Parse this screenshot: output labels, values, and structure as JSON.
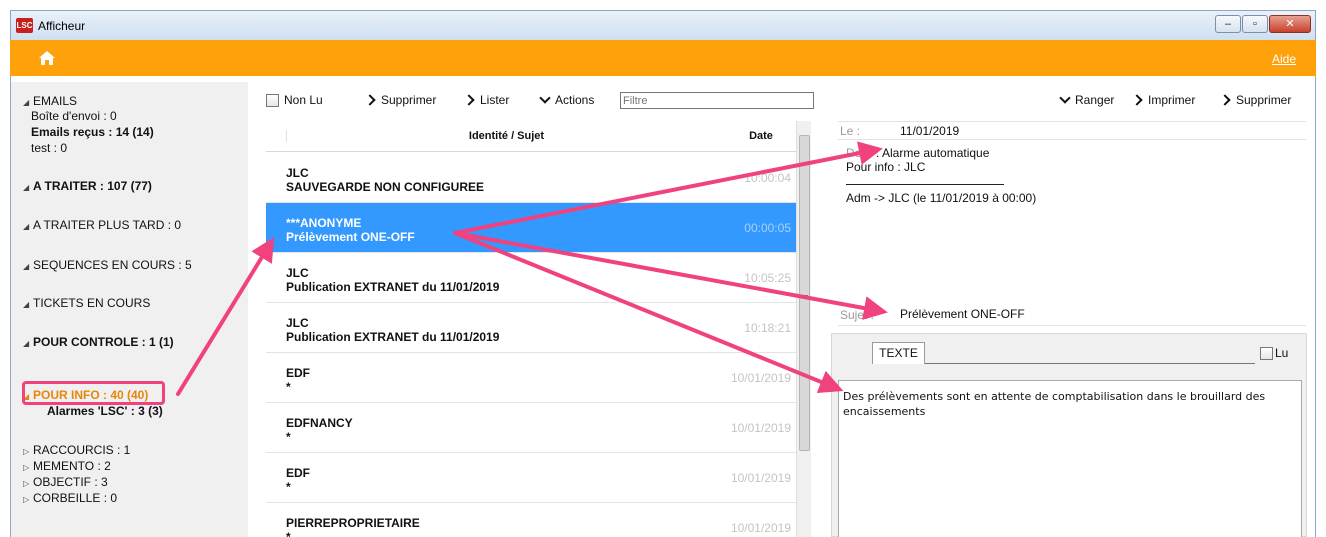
{
  "window": {
    "title": "Afficheur",
    "logo": "LSC"
  },
  "topbar": {
    "help_label": "Aide"
  },
  "sidebar": {
    "emails": "EMAILS",
    "outbox": "Boîte d'envoi : 0",
    "inbox": "Emails reçus : 14 (14)",
    "test": "test : 0",
    "a_traiter": "A TRAITER : 107 (77)",
    "a_traiter_tard": "A TRAITER PLUS TARD : 0",
    "sequences": "SEQUENCES EN COURS : 5",
    "tickets": "TICKETS EN COURS",
    "controle": "POUR CONTROLE : 1 (1)",
    "info": "POUR INFO : 40 (40)",
    "alarmes": "Alarmes 'LSC' : 3 (3)",
    "raccourcis": "RACCOURCIS : 1",
    "memento": "MEMENTO : 2",
    "objectif": "OBJECTIF : 3",
    "corbeille": "CORBEILLE : 0"
  },
  "toolbar": {
    "non_lu": "Non Lu",
    "supprimer": "Supprimer",
    "lister": "Lister",
    "actions": "Actions",
    "filter_placeholder": "Filtre"
  },
  "list": {
    "col_identity": "Identité / Sujet",
    "col_date": "Date",
    "rows": [
      {
        "sender": "JLC",
        "subject": "SAUVEGARDE NON CONFIGUREE",
        "date": "10:00:04"
      },
      {
        "sender": "***ANONYME",
        "subject": "Prélèvement ONE-OFF",
        "date": "00:00:05"
      },
      {
        "sender": "JLC",
        "subject": "Publication EXTRANET du 11/01/2019",
        "date": "10:05:25"
      },
      {
        "sender": "JLC",
        "subject": "Publication EXTRANET du 11/01/2019",
        "date": "10:18:21"
      },
      {
        "sender": "EDF",
        "subject": "*",
        "date": "10/01/2019"
      },
      {
        "sender": "EDFNANCY",
        "subject": "*",
        "date": "10/01/2019"
      },
      {
        "sender": "EDF",
        "subject": "*",
        "date": "10/01/2019"
      },
      {
        "sender": "PIERREPROPRIETAIRE",
        "subject": "*",
        "date": "10/01/2019"
      }
    ]
  },
  "detail": {
    "ranger": "Ranger",
    "imprimer": "Imprimer",
    "supprimer": "Supprimer",
    "le_label": "Le :",
    "le_value": "11/01/2019",
    "de_label": "De :",
    "de_value": ": Alarme automatique",
    "pour_info": "Pour info : JLC",
    "route": "Adm -> JLC (le 11/01/2019 à 00:00)",
    "sujet_label": "Sujet :",
    "sujet_value": "Prélèvement ONE-OFF",
    "tab_texte": "TEXTE",
    "lu_label": "Lu",
    "body": "Des prélèvements sont en attente de comptabilisation dans le brouillard des encaissements"
  },
  "colors": {
    "accent_orange": "#ffa10a",
    "selection_blue": "#3399ff",
    "annotation_pink": "#f0427e"
  }
}
